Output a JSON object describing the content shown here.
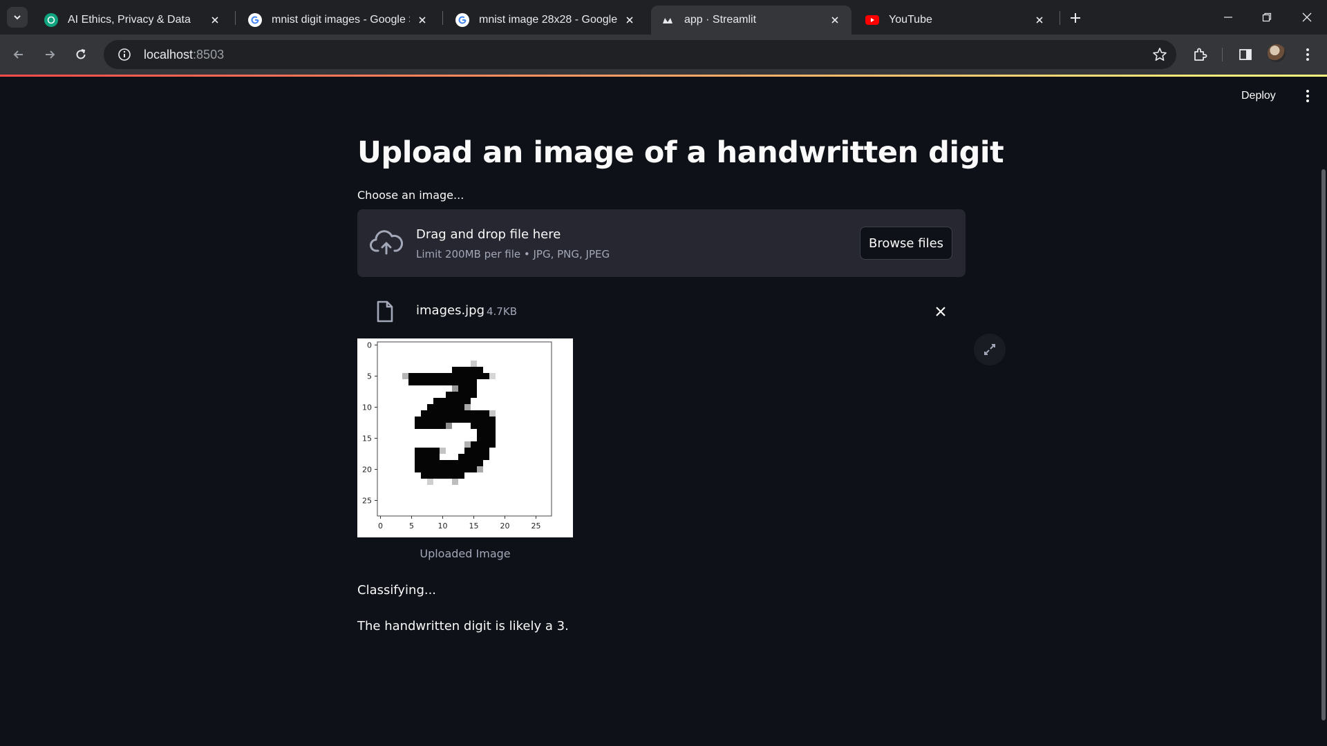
{
  "browser": {
    "tabs": [
      {
        "title": "AI Ethics, Privacy & Data",
        "icon": "chatgpt-icon"
      },
      {
        "title": "mnist digit images - Google Se",
        "icon": "google-icon"
      },
      {
        "title": "mnist image 28x28 - Google Se",
        "icon": "google-icon"
      },
      {
        "title": "app · Streamlit",
        "icon": "streamlit-icon",
        "active": true
      },
      {
        "title": "YouTube",
        "icon": "youtube-icon"
      }
    ],
    "address": {
      "host": "localhost",
      "port": ":8503"
    }
  },
  "header": {
    "deploy_label": "Deploy"
  },
  "page": {
    "title": "Upload an image of a handwritten digit",
    "uploader": {
      "label": "Choose an image...",
      "drop_title": "Drag and drop file here",
      "drop_limit": "Limit 200MB per file • JPG, PNG, JPEG",
      "browse_label": "Browse files"
    },
    "file": {
      "name": "images.jpg",
      "size": "4.7KB"
    },
    "image_caption": "Uploaded Image",
    "plot_ticks": {
      "x": [
        "0",
        "5",
        "10",
        "15",
        "20",
        "25"
      ],
      "y": [
        "0",
        "5",
        "10",
        "15",
        "20",
        "25"
      ]
    },
    "status": "Classifying...",
    "result": "The handwritten digit is likely a 3."
  },
  "colors": {
    "accent_red": "#ff4b4b",
    "background": "#0e1117",
    "secondary_bg": "#262730"
  }
}
